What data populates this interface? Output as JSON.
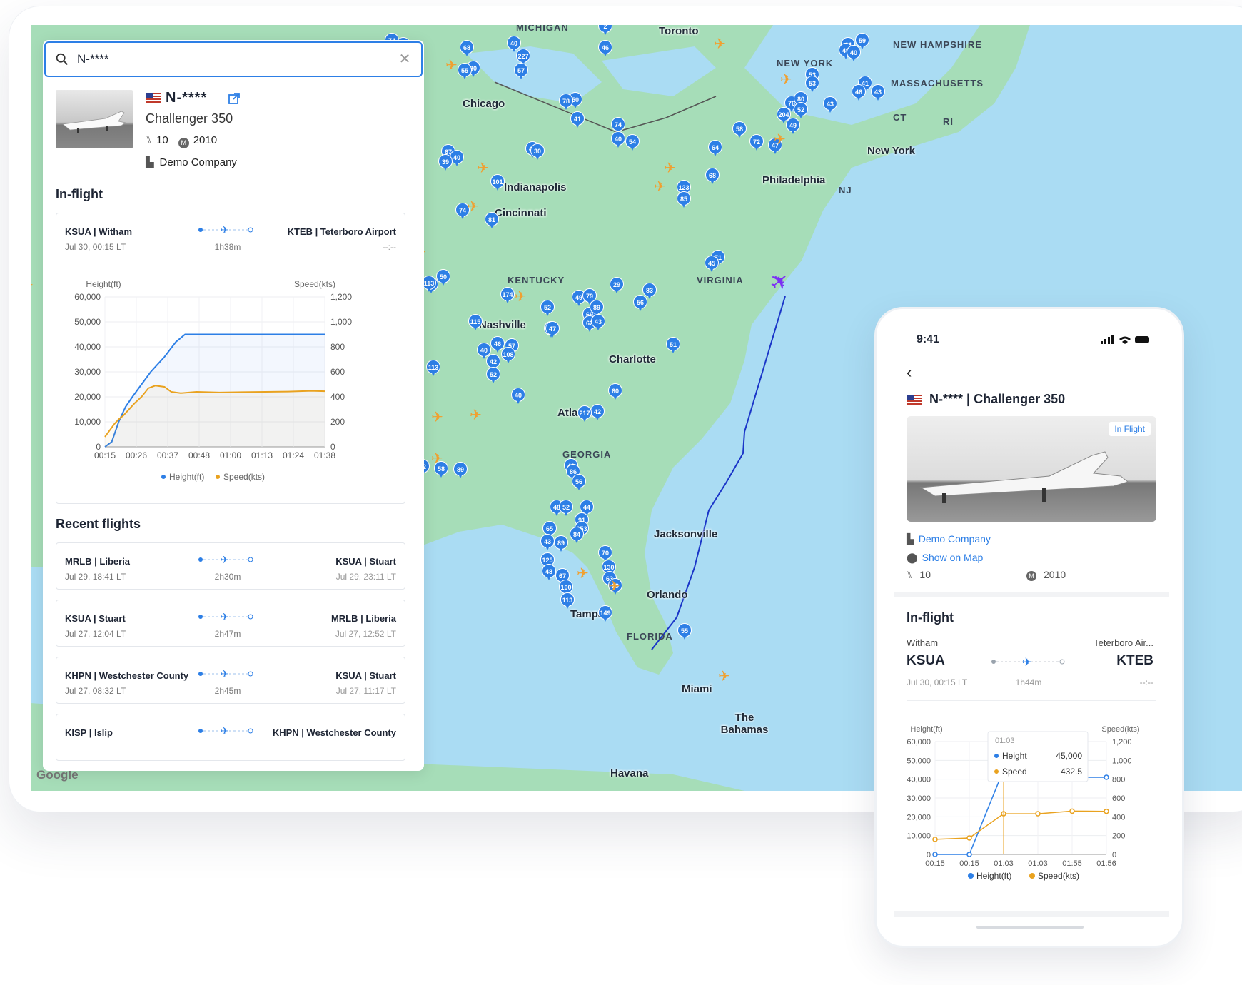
{
  "search": {
    "value": "N-****",
    "placeholder": ""
  },
  "aircraft": {
    "registration": "N-****",
    "model": "Challenger 350",
    "seats": "10",
    "year": "2010",
    "operator": "Demo Company"
  },
  "in_flight": {
    "title": "In-flight",
    "from": "KSUA | Witham",
    "to": "KTEB | Teterboro Airport",
    "departure": "Jul 30, 00:15 LT",
    "duration": "1h38m",
    "arrival": "--:--"
  },
  "panel_chart": {
    "left_axis_title": "Height(ft)",
    "right_axis_title": "Speed(kts)",
    "legend": [
      "Height(ft)",
      "Speed(kts)"
    ],
    "colors": {
      "height": "#2d7fe6",
      "speed": "#e9a21f"
    }
  },
  "chart_data": [
    {
      "type": "line",
      "title": "",
      "x": [
        "00:15",
        "00:26",
        "00:37",
        "00:48",
        "01:00",
        "01:13",
        "01:24",
        "01:38"
      ],
      "y_left": {
        "label": "Height(ft)",
        "ticks": [
          "0",
          "10,000",
          "20,000",
          "30,000",
          "40,000",
          "50,000",
          "60,000"
        ],
        "ylim": [
          0,
          60000
        ]
      },
      "y_right": {
        "label": "Speed(kts)",
        "ticks": [
          "0",
          "200",
          "400",
          "600",
          "800",
          "1,000",
          "1,200"
        ],
        "ylim": [
          0,
          1200
        ]
      },
      "series": [
        {
          "name": "Height(ft)",
          "points": [
            [
              0,
              0
            ],
            [
              3,
              2000
            ],
            [
              6,
              10000
            ],
            [
              9,
              16000
            ],
            [
              12,
              20000
            ],
            [
              16,
              25000
            ],
            [
              20,
              30000
            ],
            [
              26,
              36000
            ],
            [
              31,
              42000
            ],
            [
              35,
              45000
            ],
            [
              45,
              45000
            ],
            [
              60,
              45000
            ],
            [
              80,
              45000
            ],
            [
              96,
              45000
            ]
          ]
        },
        {
          "name": "Speed(kts)",
          "points": [
            [
              0,
              80
            ],
            [
              2,
              130
            ],
            [
              4,
              180
            ],
            [
              6,
              220
            ],
            [
              8,
              250
            ],
            [
              10,
              290
            ],
            [
              13,
              350
            ],
            [
              16,
              400
            ],
            [
              19,
              470
            ],
            [
              22,
              490
            ],
            [
              26,
              480
            ],
            [
              29,
              440
            ],
            [
              33,
              430
            ],
            [
              40,
              440
            ],
            [
              50,
              435
            ],
            [
              60,
              438
            ],
            [
              70,
              440
            ],
            [
              80,
              442
            ],
            [
              90,
              448
            ],
            [
              96,
              445
            ]
          ]
        }
      ],
      "legend": [
        "Height(ft)",
        "Speed(kts)"
      ],
      "grid": true,
      "legend_position": "bottom"
    },
    {
      "type": "line",
      "title": "",
      "x": [
        "00:15",
        "00:15",
        "01:03",
        "01:03",
        "01:55",
        "01:56"
      ],
      "y_left": {
        "label": "Height(ft)",
        "ticks": [
          "0",
          "10,000",
          "20,000",
          "30,000",
          "40,000",
          "50,000",
          "60,000"
        ],
        "ylim": [
          0,
          60000
        ]
      },
      "y_right": {
        "label": "Speed(kts)",
        "ticks": [
          "0",
          "200",
          "400",
          "600",
          "800",
          "1,000",
          "1,200"
        ],
        "ylim": [
          0,
          1200
        ]
      },
      "series": [
        {
          "name": "Height(ft)",
          "values": [
            0,
            0,
            45000,
            45000,
            41000,
            41000
          ]
        },
        {
          "name": "Speed(kts)",
          "values": [
            160,
            175,
            432.5,
            432.5,
            460,
            458
          ]
        }
      ],
      "tooltip": {
        "time": "01:03",
        "height_label": "Height",
        "height": "45,000",
        "speed_label": "Speed",
        "speed": "432.5"
      },
      "legend": [
        "Height(ft)",
        "Speed(kts)"
      ],
      "grid": true,
      "legend_position": "bottom"
    }
  ],
  "recent": {
    "title": "Recent flights",
    "flights": [
      {
        "from": "MRLB | Liberia",
        "to": "KSUA | Stuart",
        "departure": "Jul 29, 18:41 LT",
        "duration": "2h30m",
        "arrival": "Jul 29, 23:11 LT"
      },
      {
        "from": "KSUA | Stuart",
        "to": "MRLB | Liberia",
        "departure": "Jul 27, 12:04 LT",
        "duration": "2h47m",
        "arrival": "Jul 27, 12:52 LT"
      },
      {
        "from": "KHPN | Westchester County",
        "to": "KSUA | Stuart",
        "departure": "Jul 27, 08:32 LT",
        "duration": "2h45m",
        "arrival": "Jul 27, 11:17 LT"
      },
      {
        "from": "KISP | Islip",
        "to": "KHPN | Westchester County",
        "departure": "",
        "duration": "",
        "arrival": ""
      }
    ]
  },
  "map": {
    "regions": [
      "MICHIGAN",
      "NEW YORK",
      "MASSACHUSETTS",
      "CT",
      "RI",
      "NJ",
      "KENTUCKY",
      "VIRGINIA",
      "GEORGIA",
      "FLORIDA",
      "NEW HAMPSHIRE"
    ],
    "cities": [
      "Toronto",
      "Chicago",
      "Indianapolis",
      "Cincinnati",
      "Philadelphia",
      "New York",
      "Nashville",
      "Charlotte",
      "Atlanta",
      "Jacksonville",
      "Orlando",
      "Tampa",
      "Miami",
      "The Bahamas",
      "Havana"
    ],
    "attribution": "Google"
  },
  "phone": {
    "time": "9:41",
    "title_reg": "N-****",
    "title_model": "| Challenger 350",
    "badge": "In Flight",
    "company": "Demo Company",
    "show_on_map": "Show on Map",
    "seats": "10",
    "year": "2010",
    "in_flight_title": "In-flight",
    "from_name": "Witham",
    "to_name": "Teterboro Air...",
    "from_code": "KSUA",
    "to_code": "KTEB",
    "departure": "Jul 30, 00:15 LT",
    "duration": "1h44m",
    "arrival": "--:--",
    "chart_left_title": "Height(ft)",
    "chart_right_title": "Speed(kts)"
  }
}
